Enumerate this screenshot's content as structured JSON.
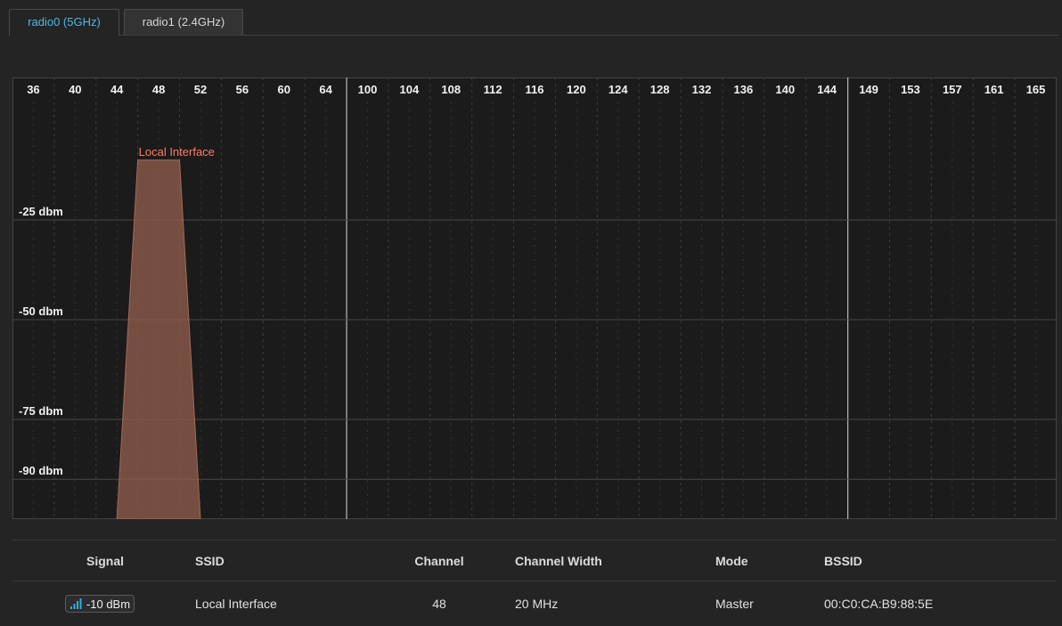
{
  "tabs": [
    {
      "label": "radio0 (5GHz)",
      "active": true
    },
    {
      "label": "radio1 (2.4GHz)",
      "active": false
    }
  ],
  "colors": {
    "active_tab": "#4fb7e9",
    "plot_bg": "#1b1b1b",
    "signal_fill": "#8a5a4b",
    "signal_label": "#ff7b63"
  },
  "chart_data": {
    "type": "area",
    "channels": [
      "36",
      "40",
      "44",
      "48",
      "52",
      "56",
      "60",
      "64",
      "100",
      "104",
      "108",
      "112",
      "116",
      "120",
      "124",
      "128",
      "132",
      "136",
      "140",
      "144",
      "149",
      "153",
      "157",
      "161",
      "165"
    ],
    "y_levels": [
      {
        "value": -25,
        "label": "-25 dbm"
      },
      {
        "value": -50,
        "label": "-50 dbm"
      },
      {
        "value": -75,
        "label": "-75 dbm"
      },
      {
        "value": -90,
        "label": "-90 dbm"
      }
    ],
    "band_separators_after": [
      "64",
      "144"
    ],
    "series": [
      {
        "name": "Local Interface",
        "channel": "48",
        "signal_dbm": -10
      }
    ],
    "ylim": [
      -100,
      0
    ],
    "grid": true
  },
  "table": {
    "headers": [
      "Signal",
      "SSID",
      "Channel",
      "Channel Width",
      "Mode",
      "BSSID"
    ],
    "rows": [
      {
        "signal_icon": "signal-strength-icon",
        "signal": "-10 dBm",
        "ssid": "Local Interface",
        "channel": "48",
        "channel_width": "20 MHz",
        "mode": "Master",
        "bssid": "00:C0:CA:B9:88:5E"
      }
    ]
  }
}
